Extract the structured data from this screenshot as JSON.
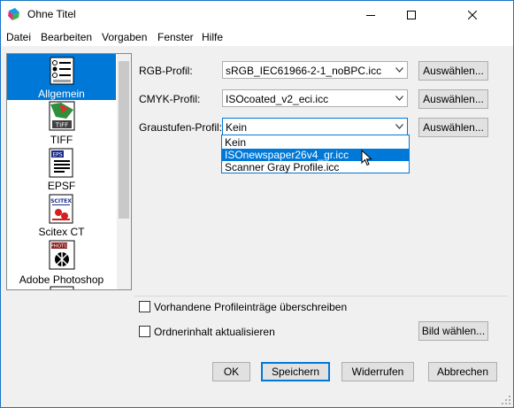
{
  "window": {
    "title": "Ohne Titel",
    "accent": "#0078d7"
  },
  "menu": {
    "items": [
      "Datei",
      "Bearbeiten",
      "Vorgaben",
      "Fenster",
      "Hilfe"
    ]
  },
  "sidebar": {
    "items": [
      {
        "label": "Allgemein",
        "icon": "settings-list-icon",
        "selected": true
      },
      {
        "label": "TIFF",
        "icon": "tiff-file-icon"
      },
      {
        "label": "EPSF",
        "icon": "epsf-file-icon"
      },
      {
        "label": "Scitex CT",
        "icon": "scitex-file-icon"
      },
      {
        "label": "Adobe Photoshop",
        "icon": "photoshop-file-icon"
      }
    ]
  },
  "profiles": {
    "rgb": {
      "label": "RGB-Profil:",
      "value": "sRGB_IEC61966-2-1_noBPC.icc",
      "button": "Auswählen..."
    },
    "cmyk": {
      "label": "CMYK-Profil:",
      "value": "ISOcoated_v2_eci.icc",
      "button": "Auswählen..."
    },
    "gray": {
      "label": "Graustufen-Profil:",
      "value": "Kein",
      "button": "Auswählen..."
    }
  },
  "gray_dropdown": {
    "options": [
      "Kein",
      "ISOnewspaper26v4_gr.icc",
      "Scanner Gray Profile.icc"
    ],
    "highlighted_index": 1
  },
  "options": {
    "overwrite": {
      "label": "Vorhandene Profileinträge überschreiben",
      "checked": false
    },
    "update_folder": {
      "label": "Ordnerinhalt aktualisieren",
      "checked": false
    },
    "choose_image_button": "Bild wählen..."
  },
  "footer": {
    "ok": "OK",
    "save": "Speichern",
    "revert": "Widerrufen",
    "cancel": "Abbrechen"
  }
}
